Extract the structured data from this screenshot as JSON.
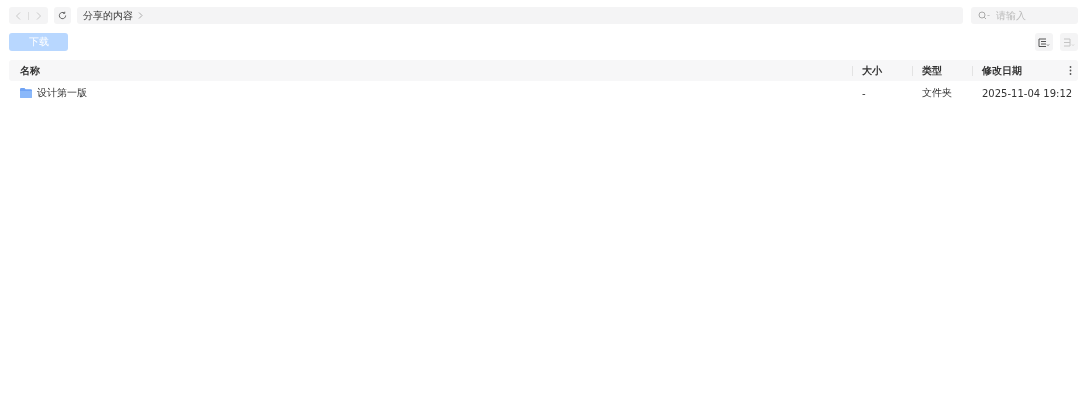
{
  "toolbar": {
    "back": {
      "disabled": true
    },
    "forward": {
      "disabled": true
    },
    "breadcrumb": [
      "分享的内容"
    ],
    "search": {
      "placeholder": "请输入"
    }
  },
  "actions": {
    "download": {
      "label": "下载",
      "disabled": true
    },
    "views": [
      {
        "kind": "list",
        "selected": true
      },
      {
        "kind": "sort",
        "selected": false
      }
    ]
  },
  "table": {
    "columns": [
      "名称",
      "大小",
      "类型",
      "修改日期"
    ],
    "rows": [
      {
        "kind": "folder",
        "name": "设计第一版",
        "size": "-",
        "type": "文件夹",
        "modified": "2025-11-04 19:12"
      }
    ]
  }
}
